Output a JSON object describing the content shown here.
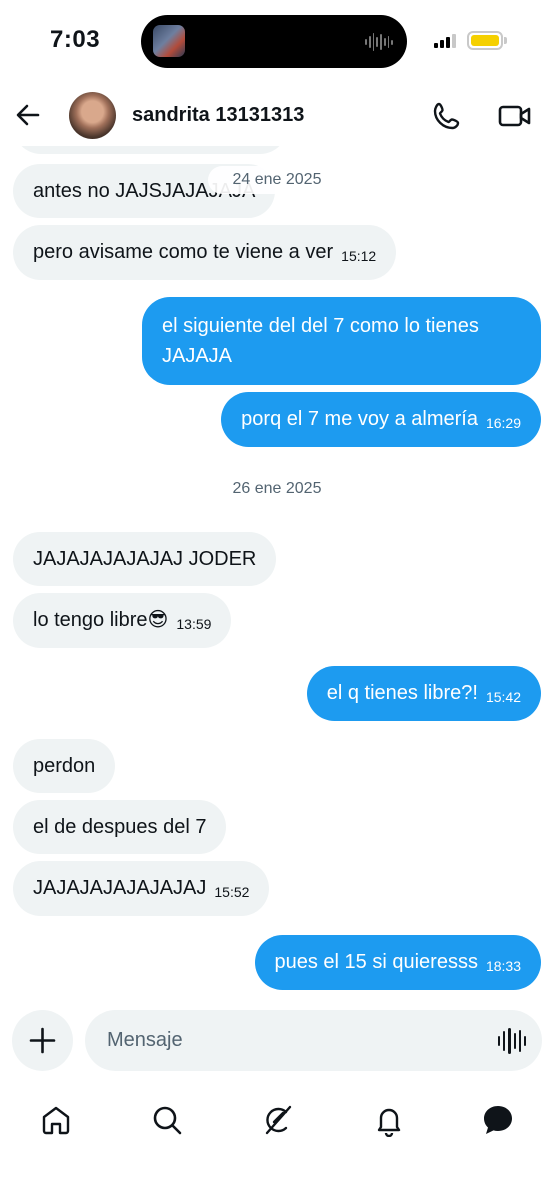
{
  "status_bar": {
    "time": "7:03"
  },
  "header": {
    "contact_name": "sandrita 13131313"
  },
  "chat": {
    "partial_message": "antes no JAJSJAJAJAJA",
    "date_label_1": "24 ene 2025",
    "messages_day1": [
      {
        "text": "pero avisame como te viene a ver",
        "time": "15:12"
      },
      {
        "text_line1": "el siguiente del del 7 como lo tienes",
        "text_line2": "JAJAJA"
      },
      {
        "text": "porq el 7 me voy a almería",
        "time": "16:29"
      }
    ],
    "date_label_2": "26 ene 2025",
    "messages_day2": [
      {
        "text": "JAJAJAJAJAJAJ JODER"
      },
      {
        "text": "lo tengo libre😎",
        "time": "13:59"
      },
      {
        "text": "el q tienes libre?!",
        "time": "15:42"
      },
      {
        "text": "perdon"
      },
      {
        "text": "el de despues del 7"
      },
      {
        "text": "JAJAJAJAJAJAJAJ",
        "time": "15:52"
      },
      {
        "text": "pues el 15 si quieresss",
        "time": "18:33"
      }
    ]
  },
  "composer": {
    "placeholder": "Mensaje"
  },
  "icons": {
    "back": "arrow-left-icon",
    "call": "phone-icon",
    "video": "video-camera-icon",
    "add": "plus-icon",
    "voice": "waveform-icon",
    "nav": [
      "home-icon",
      "search-icon",
      "grok-icon",
      "notifications-bell-icon",
      "messages-icon"
    ]
  },
  "colors": {
    "outgoing_bubble": "#1d9bf0",
    "incoming_bubble": "#eff3f4",
    "battery": "#f5d000"
  }
}
